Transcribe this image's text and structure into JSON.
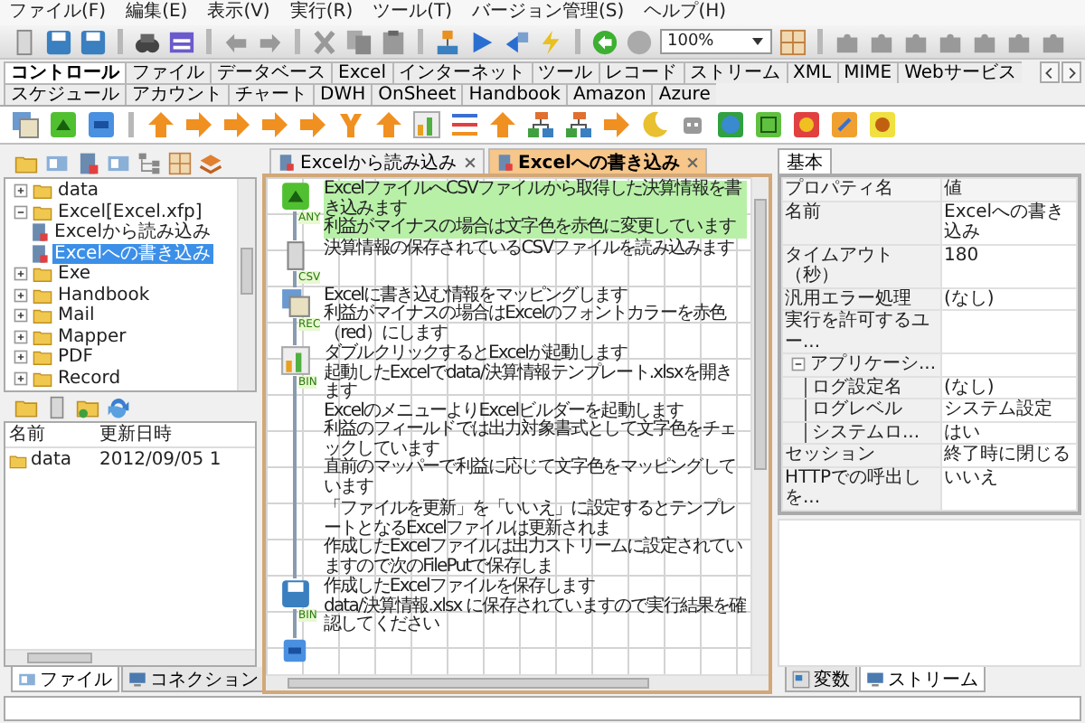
{
  "menu": [
    "ファイル(F)",
    "編集(E)",
    "表示(V)",
    "実行(R)",
    "ツール(T)",
    "バージョン管理(S)",
    "ヘルプ(H)"
  ],
  "zoom": {
    "value": "100%"
  },
  "palette_tabs": [
    {
      "label": "コントロール",
      "selected": true
    },
    {
      "label": "ファイル",
      "selected": false
    },
    {
      "label": "データベース",
      "selected": false
    },
    {
      "label": "Excel",
      "selected": false
    },
    {
      "label": "インターネット",
      "selected": false
    },
    {
      "label": "ツール",
      "selected": false
    },
    {
      "label": "レコード",
      "selected": false
    },
    {
      "label": "ストリーム",
      "selected": false
    },
    {
      "label": "XML",
      "selected": false
    },
    {
      "label": "MIME",
      "selected": false
    },
    {
      "label": "Webサービス",
      "selected": false
    },
    {
      "label": "スケジュール",
      "selected": false
    },
    {
      "label": "アカウント",
      "selected": false
    },
    {
      "label": "チャート",
      "selected": false
    },
    {
      "label": "DWH",
      "selected": false
    },
    {
      "label": "OnSheet",
      "selected": false
    },
    {
      "label": "Handbook",
      "selected": false
    },
    {
      "label": "Amazon",
      "selected": false
    },
    {
      "label": "Azure",
      "selected": false
    }
  ],
  "project_tree": [
    {
      "label": "data",
      "expanded": false,
      "selected": false
    },
    {
      "label": "Excel[Excel.xfp]",
      "expanded": true,
      "selected": false,
      "children": [
        {
          "label": "Excelから読み込み",
          "selected": false
        },
        {
          "label": "Excelへの書き込み",
          "selected": true
        }
      ]
    },
    {
      "label": "Exe",
      "expanded": false,
      "selected": false
    },
    {
      "label": "Handbook",
      "expanded": false,
      "selected": false
    },
    {
      "label": "Mail",
      "expanded": false,
      "selected": false
    },
    {
      "label": "Mapper",
      "expanded": false,
      "selected": false
    },
    {
      "label": "PDF",
      "expanded": false,
      "selected": false
    },
    {
      "label": "Record",
      "expanded": false,
      "selected": false
    }
  ],
  "file_list": {
    "columns": [
      "名前",
      "更新日時"
    ],
    "rows": [
      [
        "data",
        "2012/09/05 1"
      ]
    ]
  },
  "left_tabs": [
    {
      "label": "ファイル",
      "selected": true
    },
    {
      "label": "コネクション",
      "selected": false
    }
  ],
  "documents": [
    {
      "title": "Excelから読み込み",
      "selected": false
    },
    {
      "title": "Excelへの書き込み",
      "selected": true
    }
  ],
  "flow": [
    {
      "kind": "start",
      "connector": "ANY",
      "comments": [
        {
          "highlighted": true,
          "lines": [
            "ExcelファイルへCSVファイルから取得した決算情報を書き込みます",
            "利益がマイナスの場合は文字色を赤色に変更しています"
          ]
        }
      ]
    },
    {
      "kind": "csv_read",
      "connector": "CSV",
      "comments": [
        {
          "highlighted": false,
          "lines": [
            "決算情報の保存されているCSVファイルを読み込みます"
          ]
        }
      ]
    },
    {
      "kind": "mapper",
      "connector": "REC",
      "comments": [
        {
          "highlighted": false,
          "lines": [
            "Excelに書き込む情報をマッピングします",
            "利益がマイナスの場合はExcelのフォントカラーを赤色（red）にします"
          ]
        }
      ]
    },
    {
      "kind": "excel_builder",
      "connector": "BIN",
      "comments": [
        {
          "highlighted": false,
          "lines": [
            "ダブルクリックするとExcelが起動します",
            "起動したExcelでdata/決算情報テンプレート.xlsxを開きます",
            "ExcelのメニューよりExcelビルダーを起動します",
            "利益のフィールドでは出力対象書式として文字色をチェックしています",
            "直前のマッパーで利益に応じて文字色をマッピングしています"
          ]
        },
        {
          "highlighted": false,
          "lines": [
            "「ファイルを更新」を「いいえ」に設定するとテンプレートとなるExcelファイルは更新されま",
            "作成したExcelファイルは出力ストリームに設定されていますので次のFilePutで保存しま"
          ]
        }
      ]
    },
    {
      "kind": "file_put",
      "connector": "BIN",
      "comments": [
        {
          "highlighted": false,
          "lines": [
            "作成したExcelファイルを保存します",
            "data/決算情報.xlsx に保存されていますので実行結果を確認してください"
          ]
        }
      ]
    },
    {
      "kind": "end"
    }
  ],
  "properties": {
    "tab": "基本",
    "columns": [
      "プロパティ名",
      "値"
    ],
    "rows": [
      {
        "name": "名前",
        "value": "Excelへの書き込み"
      },
      {
        "name": "タイムアウト（秒）",
        "value": "180"
      },
      {
        "name": "汎用エラー処理",
        "value": "(なし)"
      },
      {
        "name": "実行を許可するユー..."
      },
      {
        "name": "アプリケーシ...",
        "expanded": true,
        "children": [
          {
            "name": "ログ設定名",
            "value": "(なし)"
          },
          {
            "name": "ログレベル",
            "value": "システム設定"
          },
          {
            "name": "システムロ...",
            "value": "はい"
          }
        ]
      },
      {
        "name": "セッション",
        "value": "終了時に閉じる"
      },
      {
        "name": "HTTPでの呼出しを...",
        "value": "いいえ"
      }
    ]
  },
  "right_tabs": [
    {
      "label": "変数",
      "selected": false
    },
    {
      "label": "ストリーム",
      "selected": true
    }
  ]
}
